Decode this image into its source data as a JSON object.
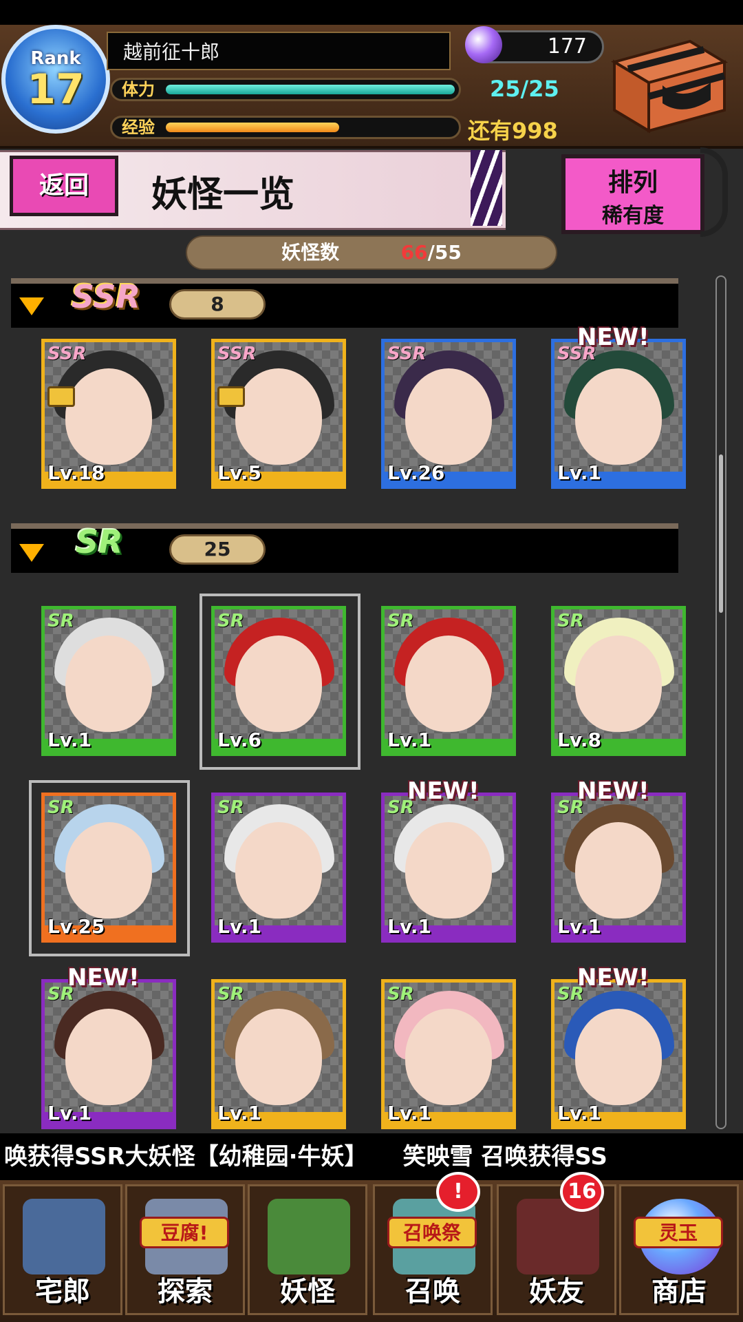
{
  "player": {
    "rank_label": "Rank",
    "rank": "17",
    "name": "越前征十郎",
    "stamina_label": "体力",
    "stamina_value": "25/25",
    "stamina_fraction": 1.0,
    "exp_label": "经验",
    "exp_remaining": "还有998",
    "exp_fraction": 0.6,
    "gems": "177"
  },
  "toolbar": {
    "back_label": "返回",
    "page_title": "妖怪一览",
    "sort_label_top": "排列",
    "sort_label_bottom": "稀有度"
  },
  "monster_count": {
    "label": "妖怪数",
    "current": "66",
    "separator": "/55"
  },
  "sections": [
    {
      "rarity": "SSR",
      "count": "8",
      "cards": [
        {
          "level": "Lv.18",
          "rarity": "SSR",
          "locked": true,
          "new": false,
          "frame": "#f0b21c",
          "hair": "#2a2a2a"
        },
        {
          "level": "Lv.5",
          "rarity": "SSR",
          "locked": true,
          "new": false,
          "frame": "#f0b21c",
          "hair": "#2a2a2a"
        },
        {
          "level": "Lv.26",
          "rarity": "SSR",
          "locked": false,
          "new": false,
          "frame": "#2d6fe0",
          "hair": "#3a2a4a"
        },
        {
          "level": "Lv.1",
          "rarity": "SSR",
          "locked": false,
          "new": true,
          "frame": "#2d6fe0",
          "hair": "#234a3a"
        }
      ]
    },
    {
      "rarity": "SR",
      "count": "25",
      "cards": [
        {
          "level": "Lv.1",
          "rarity": "SR",
          "new": false,
          "frame": "#3fb82f",
          "hair": "#dedede"
        },
        {
          "level": "Lv.6",
          "rarity": "SR",
          "new": false,
          "frame": "#3fb82f",
          "hair": "#c52222"
        },
        {
          "level": "Lv.1",
          "rarity": "SR",
          "new": false,
          "frame": "#3fb82f",
          "hair": "#c52222"
        },
        {
          "level": "Lv.8",
          "rarity": "SR",
          "new": false,
          "frame": "#3fb82f",
          "hair": "#f0f0c0"
        },
        {
          "level": "Lv.25",
          "rarity": "SR",
          "new": false,
          "frame": "#f07020",
          "hair": "#b8d4ec"
        },
        {
          "level": "Lv.1",
          "rarity": "SR",
          "new": false,
          "frame": "#8a2cc0",
          "hair": "#e8e8e8"
        },
        {
          "level": "Lv.1",
          "rarity": "SR",
          "new": true,
          "frame": "#8a2cc0",
          "hair": "#e8e8e8"
        },
        {
          "level": "Lv.1",
          "rarity": "SR",
          "new": true,
          "frame": "#8a2cc0",
          "hair": "#6a4a30"
        },
        {
          "level": "Lv.1",
          "rarity": "SR",
          "new": true,
          "frame": "#8a2cc0",
          "hair": "#4a2a22"
        },
        {
          "level": "Lv.1",
          "rarity": "SR",
          "new": false,
          "frame": "#f0b21c",
          "hair": "#8a6a4a"
        },
        {
          "level": "Lv.1",
          "rarity": "SR",
          "new": false,
          "frame": "#f0b21c",
          "hair": "#f2b8c0"
        },
        {
          "level": "Lv.1",
          "rarity": "SR",
          "new": true,
          "frame": "#f0b21c",
          "hair": "#2a5ab8"
        }
      ]
    }
  ],
  "new_label": "NEW!",
  "ticker": "唤获得SSR大妖怪【幼稚园·牛妖】　　笑映雪 召唤获得SS",
  "nav": [
    {
      "label": "宅郎",
      "icon": "house-icon",
      "color": "#4a6a9a"
    },
    {
      "label": "探索",
      "icon": "explore-icon",
      "chip": "豆腐!",
      "color": "#7a8aa8"
    },
    {
      "label": "妖怪",
      "icon": "monster-scroll-icon",
      "color": "#4a8a3a"
    },
    {
      "label": "召唤",
      "icon": "summon-icon",
      "chip": "召唤祭",
      "badge": "!",
      "color": "#5aa0a0"
    },
    {
      "label": "妖友",
      "icon": "friend-icon",
      "badge": "16",
      "color": "#6a2a2a"
    },
    {
      "label": "商店",
      "icon": "shop-orb-icon",
      "chip": "灵玉",
      "color": "#5a7ad8"
    }
  ]
}
